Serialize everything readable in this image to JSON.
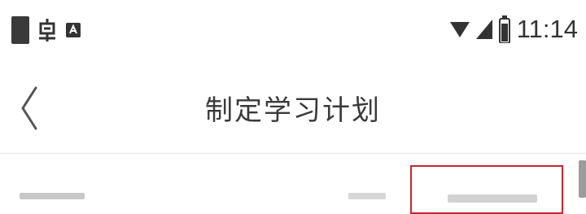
{
  "status_bar": {
    "time": "11:14",
    "left_icons": [
      "status-square-icon",
      "app-notification-icon",
      "android-notification-icon"
    ],
    "right_icons": [
      "wifi-icon",
      "signal-icon",
      "battery-icon"
    ]
  },
  "nav": {
    "back_icon": "chevron-left-icon",
    "title": "制定学习计划"
  },
  "colors": {
    "accent_border": "#c9252f",
    "text": "#333333",
    "background": "#ffffff"
  }
}
